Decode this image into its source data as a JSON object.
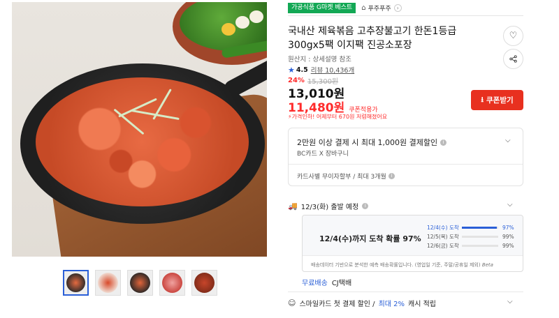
{
  "gallery": {
    "thumbnails": [
      "thumb-1",
      "thumb-2",
      "thumb-3",
      "thumb-4",
      "thumb-5"
    ]
  },
  "badges": {
    "best": "가공식품 G마켓 베스트",
    "shop_name": "푸주푸주"
  },
  "product": {
    "title": "국내산 제육볶음 고추장불고기 한돈1등급 300gx5팩 이지팩 진공소포장",
    "origin": "원산지 : 상세설명 참조",
    "rating": "4.5",
    "reviews": "리뷰 10,436개"
  },
  "price": {
    "discount": "24%",
    "original": "15,300원",
    "sale": "13,010원",
    "coupon_price": "11,480원",
    "coupon_tag": "쿠폰적용가",
    "notice": "가격인하! 어제부터 670원 저렴해졌어요"
  },
  "coupon_button": "쿠폰받기",
  "payment": {
    "title": "2만원 이상 결제 시 최대 1,000원 결제할인",
    "sub": "BC카드 X 장바구니",
    "card": "카드사별 무이자할부 / 최대 3개월"
  },
  "shipping": {
    "depart": "12/3(화) 출발 예정",
    "probability": "12/4(수)까지 도착 확률 97%",
    "rows": [
      {
        "date": "12/4(수) 도착",
        "pct": "97%",
        "value": 0.97
      },
      {
        "date": "12/5(목) 도착",
        "pct": "99%",
        "value": 0.99
      },
      {
        "date": "12/6(금) 도착",
        "pct": "99%",
        "value": 0.99
      }
    ],
    "note": "배송데이터 기반으로 분석한 예측 배송확률입니다. (영업일 기준, 주말/공휴일 제외)",
    "beta": "Beta",
    "free": "무료배송",
    "carrier": "CJ택배"
  },
  "smile": {
    "text_a": "스마일카드 첫 결제 할인 /",
    "text_b": "최대 2%",
    "text_c": "캐시 적립"
  }
}
